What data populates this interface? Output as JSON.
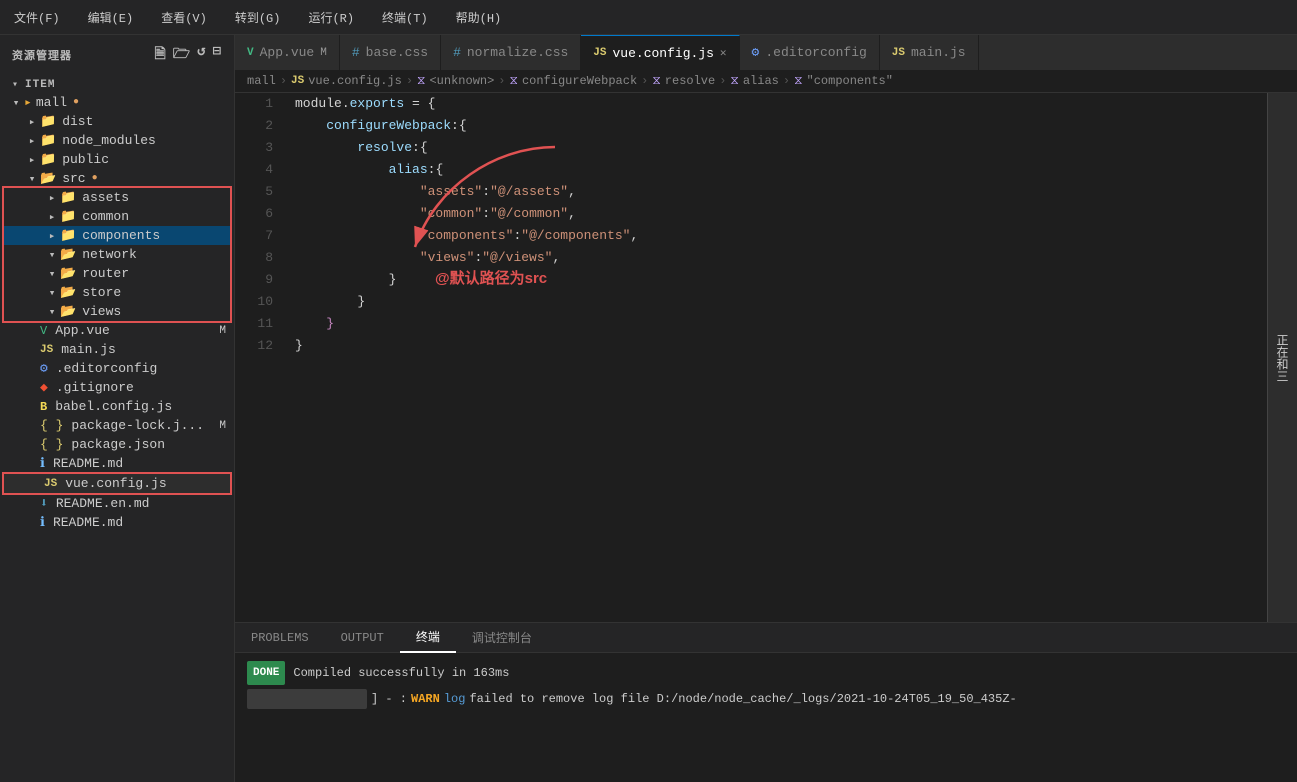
{
  "titlebar": {
    "menus": [
      "文件(F)",
      "编辑(E)",
      "查看(V)",
      "转到(G)",
      "运行(R)",
      "终端(T)",
      "帮助(H)"
    ]
  },
  "sidebar": {
    "header": "资源管理器",
    "tree": [
      {
        "id": "mall",
        "label": "mall",
        "type": "folder",
        "indent": 0,
        "expanded": true,
        "badge": "●"
      },
      {
        "id": "dist",
        "label": "dist",
        "type": "folder",
        "indent": 1,
        "expanded": false
      },
      {
        "id": "node_modules",
        "label": "node_modules",
        "type": "folder",
        "indent": 1,
        "expanded": false
      },
      {
        "id": "public",
        "label": "public",
        "type": "folder",
        "indent": 1,
        "expanded": false
      },
      {
        "id": "src",
        "label": "src",
        "type": "folder",
        "indent": 1,
        "expanded": true,
        "badge": "●"
      },
      {
        "id": "assets",
        "label": "assets",
        "type": "folder",
        "indent": 2,
        "expanded": false
      },
      {
        "id": "common",
        "label": "common",
        "type": "folder",
        "indent": 2,
        "expanded": false
      },
      {
        "id": "components",
        "label": "components",
        "type": "folder",
        "indent": 2,
        "expanded": false,
        "active": true
      },
      {
        "id": "network",
        "label": "network",
        "type": "folder",
        "indent": 2,
        "expanded": true
      },
      {
        "id": "router",
        "label": "router",
        "type": "folder",
        "indent": 2,
        "expanded": true
      },
      {
        "id": "store",
        "label": "store",
        "type": "folder",
        "indent": 2,
        "expanded": true
      },
      {
        "id": "views",
        "label": "views",
        "type": "folder",
        "indent": 2,
        "expanded": true
      },
      {
        "id": "App.vue",
        "label": "App.vue",
        "type": "vue",
        "indent": 1,
        "badge": "M"
      },
      {
        "id": "main.js",
        "label": "main.js",
        "type": "js",
        "indent": 1
      },
      {
        "id": ".editorconfig",
        "label": ".editorconfig",
        "type": "config",
        "indent": 1
      },
      {
        "id": ".gitignore",
        "label": ".gitignore",
        "type": "git",
        "indent": 1
      },
      {
        "id": "babel.config.js",
        "label": "babel.config.js",
        "type": "babel",
        "indent": 1
      },
      {
        "id": "package-lock.json",
        "label": "package-lock.j...",
        "type": "json",
        "indent": 1,
        "badge": "M"
      },
      {
        "id": "package.json",
        "label": "package.json",
        "type": "json",
        "indent": 1
      },
      {
        "id": "README.md",
        "label": "README.md",
        "type": "info",
        "indent": 1
      },
      {
        "id": "vue.config.js",
        "label": "vue.config.js",
        "type": "js",
        "indent": 1,
        "highlighted": true
      },
      {
        "id": "README.en.md",
        "label": "README.en.md",
        "type": "download",
        "indent": 1
      },
      {
        "id": "README.md2",
        "label": "README.md",
        "type": "info",
        "indent": 1
      }
    ]
  },
  "tabs": [
    {
      "id": "app-vue",
      "label": "App.vue",
      "icon": "vue",
      "badge": "M",
      "active": false
    },
    {
      "id": "base-css",
      "label": "base.css",
      "icon": "css",
      "active": false
    },
    {
      "id": "normalize-css",
      "label": "normalize.css",
      "icon": "css",
      "active": false
    },
    {
      "id": "vue-config",
      "label": "vue.config.js",
      "icon": "js",
      "active": true,
      "closable": true
    },
    {
      "id": "editorconfig",
      "label": ".editorconfig",
      "icon": "config",
      "active": false
    },
    {
      "id": "main-js",
      "label": "main.js",
      "icon": "js",
      "active": false
    }
  ],
  "breadcrumb": {
    "items": [
      "mall",
      "vue.config.js",
      "<unknown>",
      "configureWebpack",
      "resolve",
      "alias",
      "\"components\""
    ]
  },
  "code": {
    "lines": [
      {
        "num": 1,
        "tokens": [
          {
            "text": "module",
            "cls": "c-white"
          },
          {
            "text": ".",
            "cls": "c-white"
          },
          {
            "text": "exports",
            "cls": "c-prop"
          },
          {
            "text": " = {",
            "cls": "c-white"
          }
        ]
      },
      {
        "num": 2,
        "tokens": [
          {
            "text": "    configureWebpack:{",
            "cls": "c-prop"
          }
        ]
      },
      {
        "num": 3,
        "tokens": [
          {
            "text": "        resolve:{",
            "cls": "c-prop"
          }
        ]
      },
      {
        "num": 4,
        "tokens": [
          {
            "text": "            alias:{",
            "cls": "c-prop"
          }
        ]
      },
      {
        "num": 5,
        "tokens": [
          {
            "text": "                ",
            "cls": ""
          },
          {
            "text": "\"assets\"",
            "cls": "c-string"
          },
          {
            "text": ":",
            "cls": "c-white"
          },
          {
            "text": "\"@/assets\"",
            "cls": "c-string"
          },
          {
            "text": ",",
            "cls": "c-white"
          }
        ]
      },
      {
        "num": 6,
        "tokens": [
          {
            "text": "                ",
            "cls": ""
          },
          {
            "text": "\"common\"",
            "cls": "c-string"
          },
          {
            "text": ":",
            "cls": "c-white"
          },
          {
            "text": "\"@/common\"",
            "cls": "c-string"
          },
          {
            "text": ",",
            "cls": "c-white"
          }
        ]
      },
      {
        "num": 7,
        "tokens": [
          {
            "text": "                ",
            "cls": ""
          },
          {
            "text": "\"components\"",
            "cls": "c-string"
          },
          {
            "text": ":",
            "cls": "c-white"
          },
          {
            "text": "\"@/components\"",
            "cls": "c-string"
          },
          {
            "text": ",",
            "cls": "c-white"
          }
        ]
      },
      {
        "num": 8,
        "tokens": [
          {
            "text": "                ",
            "cls": ""
          },
          {
            "text": "\"views\"",
            "cls": "c-string"
          },
          {
            "text": ":",
            "cls": "c-white"
          },
          {
            "text": "\"@/views\"",
            "cls": "c-string"
          },
          {
            "text": ",",
            "cls": "c-white"
          }
        ]
      },
      {
        "num": 9,
        "tokens": [
          {
            "text": "            }",
            "cls": "c-white"
          }
        ]
      },
      {
        "num": 10,
        "tokens": [
          {
            "text": "        }",
            "cls": "c-white"
          }
        ]
      },
      {
        "num": 11,
        "tokens": [
          {
            "text": "    }",
            "cls": "c-purple"
          }
        ]
      },
      {
        "num": 12,
        "tokens": [
          {
            "text": "}",
            "cls": "c-white"
          }
        ]
      }
    ],
    "annotation": "@默认路径为src"
  },
  "terminal": {
    "tabs": [
      "PROBLEMS",
      "OUTPUT",
      "终端",
      "调试控制台"
    ],
    "active_tab": "终端",
    "done_text": "DONE",
    "success_msg": "Compiled successfully in 163ms",
    "warn_line": "] - : WARN log failed to remove log file D:/node/node_cache/_logs/2021-10-24T05_19_50_435Z-"
  },
  "right_hint": "正在和三"
}
